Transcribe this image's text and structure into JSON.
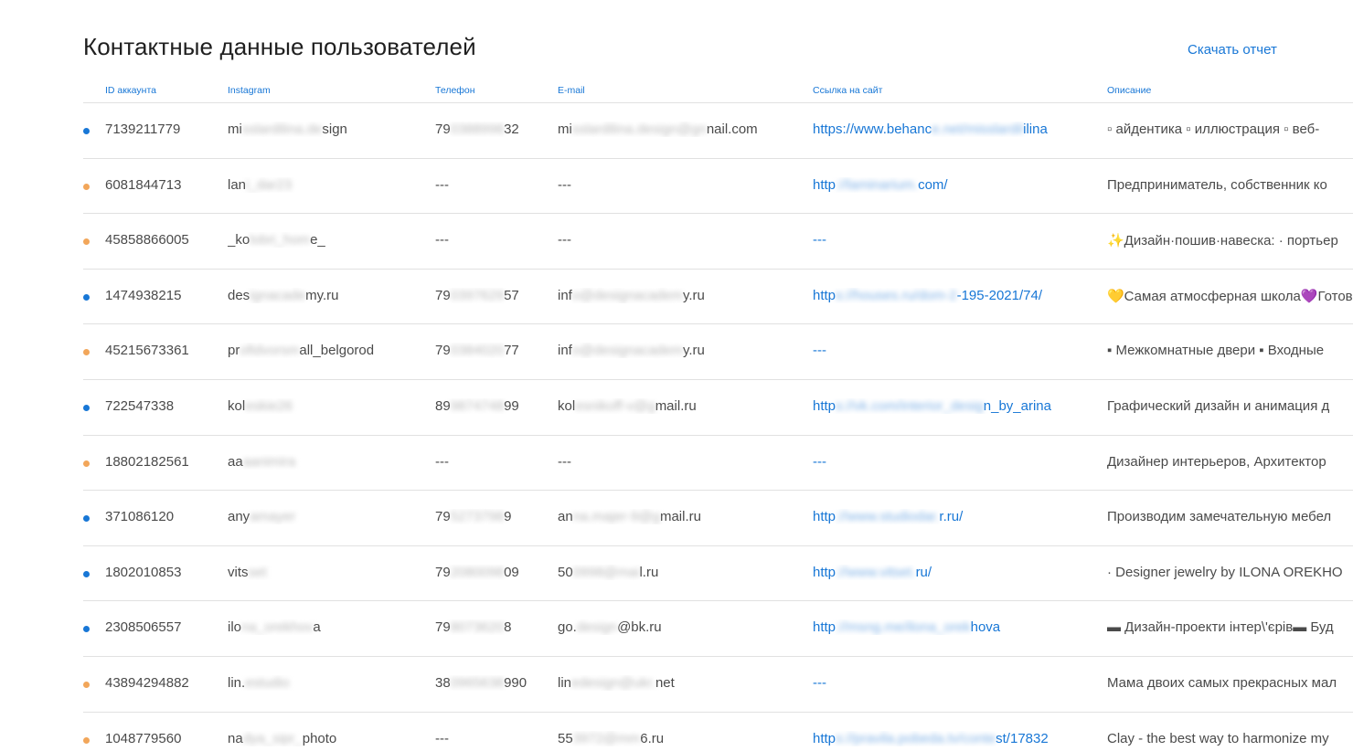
{
  "page": {
    "title": "Контактные данные пользователей",
    "download_label": "Скачать отчет"
  },
  "colors": {
    "accent": "#1877d6",
    "dot_blue": "#1877d6",
    "dot_orange": "#f2a65a"
  },
  "columns": {
    "id": "ID аккаунта",
    "instagram": "Instagram",
    "phone": "Телефон",
    "email": "E-mail",
    "site": "Ссылка на сайт",
    "description": "Описание"
  },
  "rows": [
    {
      "status": "blue",
      "id": "7139211779",
      "instagram": {
        "a": "mi",
        "b": "sslardilina.de",
        "c": "sign"
      },
      "phone": {
        "a": "79",
        "b": "0388998",
        "c": "32"
      },
      "email": {
        "a": "mi",
        "b": "sslardilina.design@gn",
        "c": "nail.com"
      },
      "site": {
        "a": "https://www.behanc",
        "b": "e.net/misslardil",
        "c": "ilina"
      },
      "description": "▫ айдентика ▫ иллюстрация ▫ веб-"
    },
    {
      "status": "orange",
      "id": "6081844713",
      "instagram": {
        "a": "lan",
        "b": "i_dar23",
        "c": ""
      },
      "phone": {
        "a": "---",
        "b": "",
        "c": ""
      },
      "email": {
        "a": "---",
        "b": "",
        "c": ""
      },
      "site": {
        "a": "http",
        "b": "://laminarium.",
        "c": "com/"
      },
      "description": "Предприниматель, собственник ко"
    },
    {
      "status": "orange",
      "id": "45858866005",
      "instagram": {
        "a": "_ko",
        "b": "lobri_hom",
        "c": "e_"
      },
      "phone": {
        "a": "---",
        "b": "",
        "c": ""
      },
      "email": {
        "a": "---",
        "b": "",
        "c": ""
      },
      "site": {
        "a": "---",
        "b": "",
        "c": ""
      },
      "description": "✨Дизайн·пошив·навеска: · портьер"
    },
    {
      "status": "blue",
      "id": "1474938215",
      "instagram": {
        "a": "des",
        "b": "ignacade",
        "c": "my.ru"
      },
      "phone": {
        "a": "79",
        "b": "0397629",
        "c": "57"
      },
      "email": {
        "a": "inf",
        "b": "o@designacadem",
        "c": "y.ru"
      },
      "site": {
        "a": "http",
        "b": "s://houses.ru/dom-2",
        "c": "-195-2021/74/"
      },
      "description": "💛Самая атмосферная школа💜Готов"
    },
    {
      "status": "orange",
      "id": "45215673361",
      "instagram": {
        "a": "pr",
        "b": "ofidvorsm",
        "c": "all_belgorod"
      },
      "phone": {
        "a": "79",
        "b": "0384020",
        "c": "77"
      },
      "email": {
        "a": "inf",
        "b": "o@designacadem",
        "c": "y.ru"
      },
      "site": {
        "a": "---",
        "b": "",
        "c": ""
      },
      "description": "▪ Межкомнатные двери ▪ Входные"
    },
    {
      "status": "blue",
      "id": "722547338",
      "instagram": {
        "a": "kol",
        "b": "eskie26",
        "c": ""
      },
      "phone": {
        "a": "89",
        "b": "9874748",
        "c": "99"
      },
      "email": {
        "a": "kol",
        "b": "esnikoff-v@g",
        "c": "mail.ru"
      },
      "site": {
        "a": "http",
        "b": "s://vk.com/interior_desig",
        "c": "n_by_arina"
      },
      "description": "Графический дизайн и анимация д"
    },
    {
      "status": "orange",
      "id": "18802182561",
      "instagram": {
        "a": "aa",
        "b": "aanimira",
        "c": ""
      },
      "phone": {
        "a": "---",
        "b": "",
        "c": ""
      },
      "email": {
        "a": "---",
        "b": "",
        "c": ""
      },
      "site": {
        "a": "---",
        "b": "",
        "c": ""
      },
      "description": "Дизайнер интерьеров, Архитектор"
    },
    {
      "status": "blue",
      "id": "371086120",
      "instagram": {
        "a": "any",
        "b": "amayer",
        "c": ""
      },
      "phone": {
        "a": "79",
        "b": "5273798",
        "c": "9"
      },
      "email": {
        "a": "an",
        "b": "na.majer-9@g",
        "c": "mail.ru"
      },
      "site": {
        "a": "http",
        "b": "://www.studiodar.",
        "c": "r.ru/"
      },
      "description": "Производим замечательную мебел"
    },
    {
      "status": "blue",
      "id": "1802010853",
      "instagram": {
        "a": "vits",
        "b": "set",
        "c": ""
      },
      "phone": {
        "a": "79",
        "b": "2080098",
        "c": "09"
      },
      "email": {
        "a": "50",
        "b": "0998@mai",
        "c": "l.ru"
      },
      "site": {
        "a": "http",
        "b": "://www.vitset.",
        "c": "ru/"
      },
      "description": "· Designer jewelry by ILONA OREKHO"
    },
    {
      "status": "blue",
      "id": "2308506557",
      "instagram": {
        "a": "ilo",
        "b": "na_orekhov",
        "c": "a"
      },
      "phone": {
        "a": "79",
        "b": "8073620",
        "c": "8"
      },
      "email": {
        "a": "go.",
        "b": "design",
        "c": "@bk.ru"
      },
      "site": {
        "a": "http",
        "b": "://msng.me/ilona_orek",
        "c": "hova"
      },
      "description": "▬ Дизайн-проекти інтер\\'єрів▬ Буд"
    },
    {
      "status": "orange",
      "id": "43894294882",
      "instagram": {
        "a": "lin.",
        "b": "estudio",
        "c": ""
      },
      "phone": {
        "a": "38",
        "b": "0965638",
        "c": "990"
      },
      "email": {
        "a": "lin",
        "b": "edesign@ukr.",
        "c": "net"
      },
      "site": {
        "a": "---",
        "b": "",
        "c": ""
      },
      "description": "Мама двоих самых прекрасных мал"
    },
    {
      "status": "orange",
      "id": "1048779560",
      "instagram": {
        "a": "na",
        "b": "dya_sipr_",
        "c": "photo"
      },
      "phone": {
        "a": "---",
        "b": "",
        "c": ""
      },
      "email": {
        "a": "55",
        "b": "3972@mm",
        "c": "6.ru"
      },
      "site": {
        "a": "http",
        "b": "s://pravila.pobedа.tv/conte",
        "c": "st/17832"
      },
      "description": "Clay - the best way to harmonize my"
    }
  ]
}
